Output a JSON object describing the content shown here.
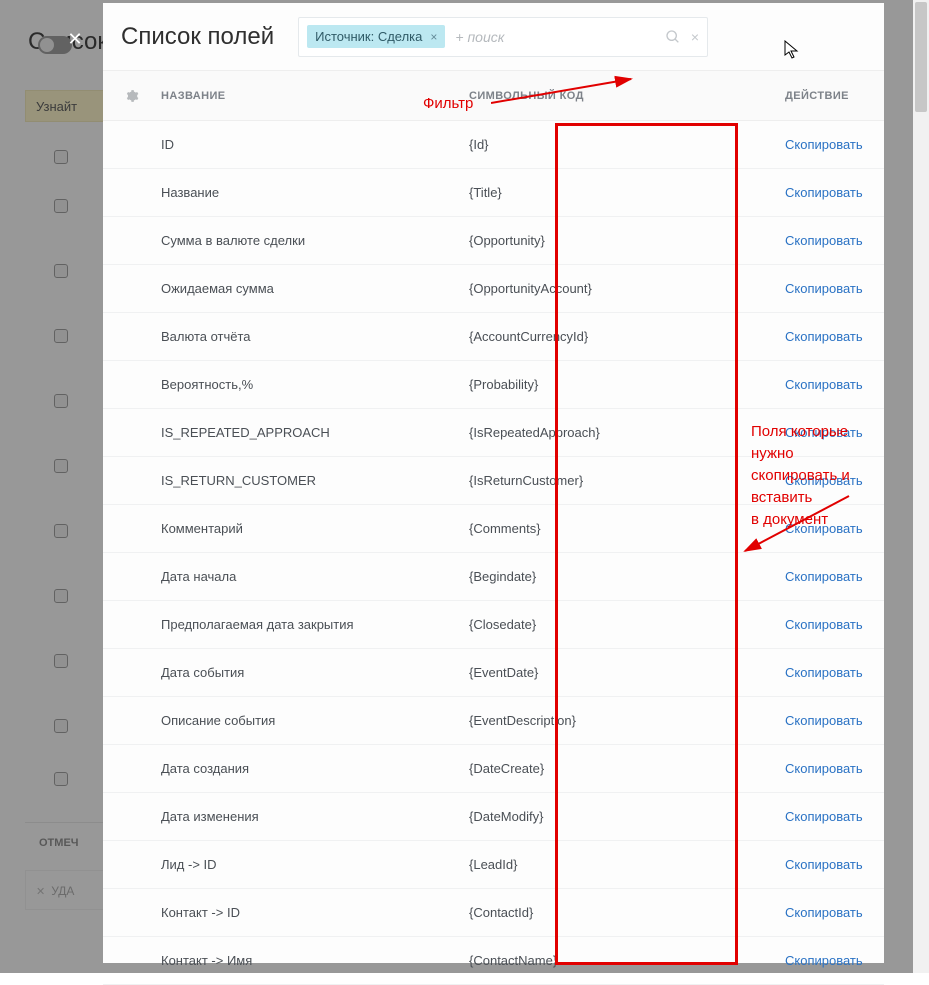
{
  "background": {
    "title": "Список",
    "learn_more": "Узнайт",
    "marked_label": "ОТМЕЧ",
    "delete_label": "УДА"
  },
  "modal": {
    "title": "Список полей",
    "filter_chip": "Источник: Сделка",
    "search_placeholder": "+ поиск"
  },
  "columns": {
    "name": "НАЗВАНИЕ",
    "code": "СИМВОЛЬНЫЙ КОД",
    "action": "ДЕЙСТВИЕ"
  },
  "action_label": "Скопировать",
  "annotations": {
    "filter_label": "Фильтр",
    "copy_hint_l1": "Поля которые нужно",
    "copy_hint_l2": "скопировать и вставить",
    "copy_hint_l3": "в документ"
  },
  "rows": [
    {
      "name": "ID",
      "code": "{Id}"
    },
    {
      "name": "Название",
      "code": "{Title}"
    },
    {
      "name": "Сумма в валюте сделки",
      "code": "{Opportunity}"
    },
    {
      "name": "Ожидаемая сумма",
      "code": "{OpportunityAccount}"
    },
    {
      "name": "Валюта отчёта",
      "code": "{AccountCurrencyId}"
    },
    {
      "name": "Вероятность,%",
      "code": "{Probability}"
    },
    {
      "name": "IS_REPEATED_APPROACH",
      "code": "{IsRepeatedApproach}"
    },
    {
      "name": "IS_RETURN_CUSTOMER",
      "code": "{IsReturnCustomer}"
    },
    {
      "name": "Комментарий",
      "code": "{Comments}"
    },
    {
      "name": "Дата начала",
      "code": "{Begindate}"
    },
    {
      "name": "Предполагаемая дата закрытия",
      "code": "{Closedate}"
    },
    {
      "name": "Дата события",
      "code": "{EventDate}"
    },
    {
      "name": "Описание события",
      "code": "{EventDescription}"
    },
    {
      "name": "Дата создания",
      "code": "{DateCreate}"
    },
    {
      "name": "Дата изменения",
      "code": "{DateModify}"
    },
    {
      "name": "Лид -> ID",
      "code": "{LeadId}"
    },
    {
      "name": "Контакт -> ID",
      "code": "{ContactId}"
    },
    {
      "name": "Контакт -> Имя",
      "code": "{ContactName}"
    }
  ],
  "bg_checkbox_tops": [
    150,
    199,
    264,
    329,
    394,
    459,
    524,
    589,
    654,
    719,
    772
  ]
}
